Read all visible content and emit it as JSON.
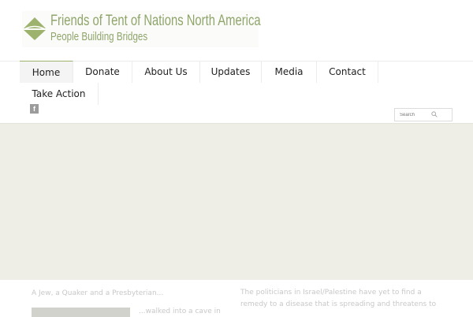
{
  "site": {
    "title": "Friends of Tent of Nations North America",
    "tagline": "People Building Bridges",
    "logo_icon": "diamond-leaf-icon",
    "brand_color": "#8fa56a"
  },
  "nav": {
    "items": [
      {
        "label": "Home",
        "active": true
      },
      {
        "label": "Donate"
      },
      {
        "label": "About Us"
      },
      {
        "label": "Updates"
      },
      {
        "label": "Media"
      },
      {
        "label": "Contact"
      },
      {
        "label": "Take Action"
      }
    ],
    "accent_color": "#9cb26d"
  },
  "social": {
    "facebook_icon": "facebook-icon",
    "facebook_glyph": "f"
  },
  "search": {
    "placeholder": "Search",
    "icon": "search-icon"
  },
  "banner": {
    "color": "#eeeee6"
  },
  "content": {
    "post_title": "A Jew, a Quaker and a Presbyterian...",
    "post_excerpt": "...walked into a cave in",
    "side_text": "The politicians in Israel/Palestine have yet to find a remedy to a disease that is spreading and threatens to"
  }
}
